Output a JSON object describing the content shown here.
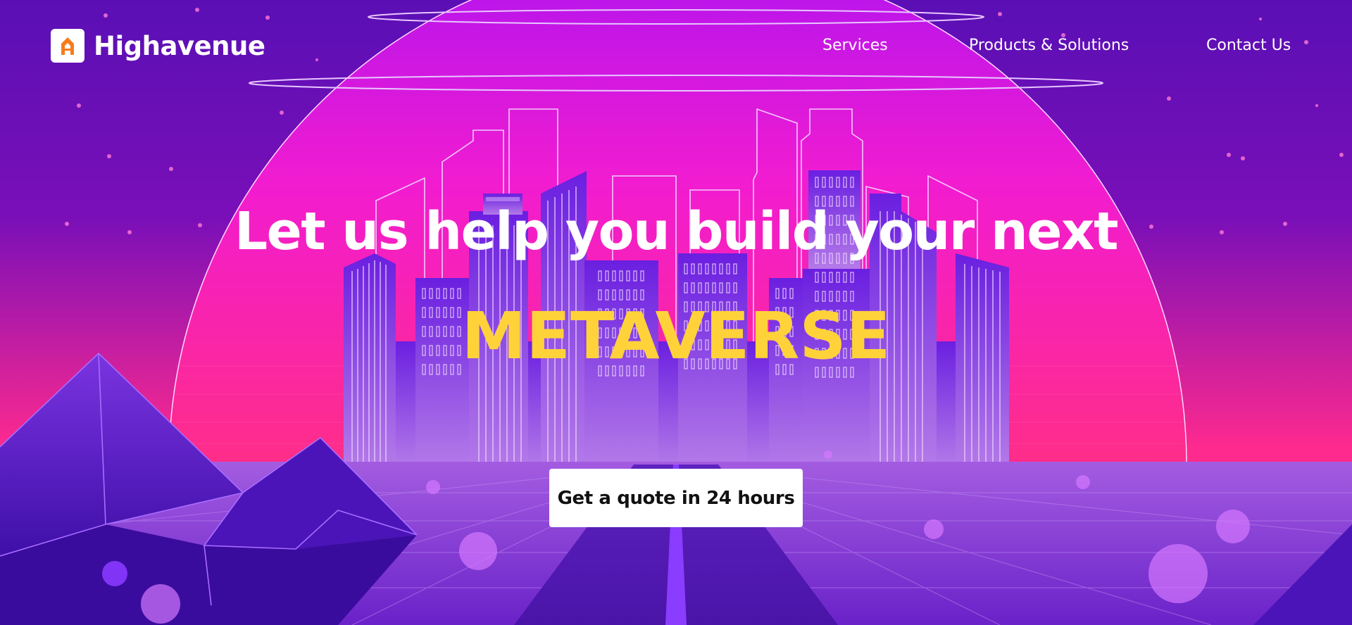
{
  "brand": {
    "name": "Highavenue",
    "logo_icon": "highavenue-logo-icon",
    "logo_color": "#f57c1f"
  },
  "nav": {
    "items": [
      {
        "label": "Services"
      },
      {
        "label": "Products & Solutions"
      },
      {
        "label": "Contact Us"
      }
    ]
  },
  "hero": {
    "headline": "Let us help you build your next",
    "highlight": "METAVERSE",
    "cta_label": "Get a quote in 24 hours",
    "background": "synthwave-city-illustration"
  },
  "colors": {
    "sky_top": "#5a0fb5",
    "sun_top": "#b114f0",
    "sun_bottom": "#ff2a8e",
    "highlight_text": "#ffd23a",
    "cta_background": "#ffffff",
    "cta_text": "#111111"
  }
}
